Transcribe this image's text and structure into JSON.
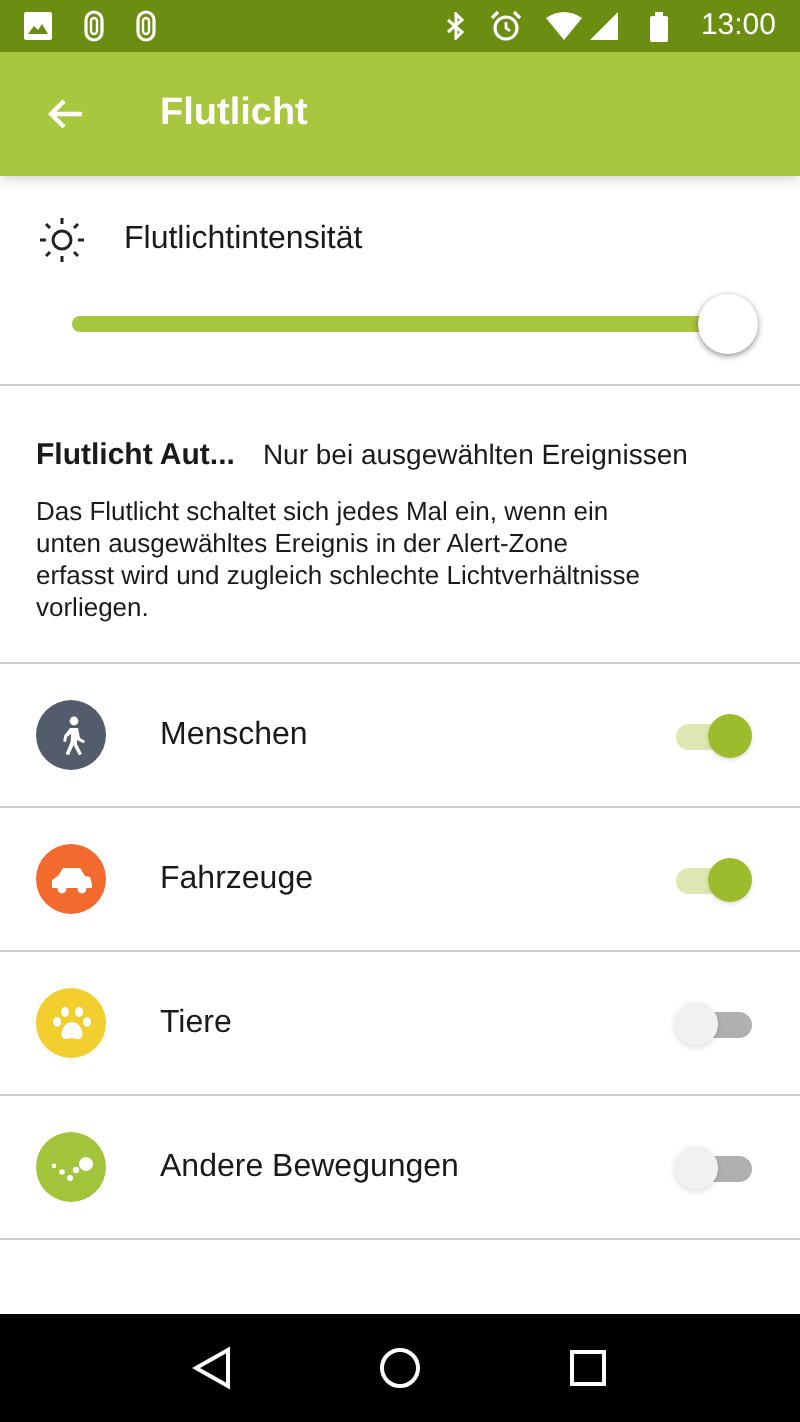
{
  "status_bar": {
    "time": "13:00"
  },
  "app_bar": {
    "title": "Flutlicht"
  },
  "intensity": {
    "label": "Flutlichtintensität",
    "level": 1.0
  },
  "auto": {
    "label": "Flutlicht Aut...",
    "value": "Nur bei ausgewählten Ereignissen",
    "description": "Das Flutlicht schaltet sich jedes Mal ein, wenn ein unten ausgewähltes Ereignis in der Alert-Zone erfasst wird und zugleich schlechte Lichtverhältnisse vorliegen."
  },
  "events": [
    {
      "label": "Menschen",
      "kind": "person",
      "color": "#535c6b",
      "on": true
    },
    {
      "label": "Fahrzeuge",
      "kind": "car",
      "color": "#f26a2e",
      "on": true
    },
    {
      "label": "Tiere",
      "kind": "paw",
      "color": "#f2cf2e",
      "on": false
    },
    {
      "label": "Andere Bewegungen",
      "kind": "motion",
      "color": "#a2c43a",
      "on": false
    }
  ]
}
